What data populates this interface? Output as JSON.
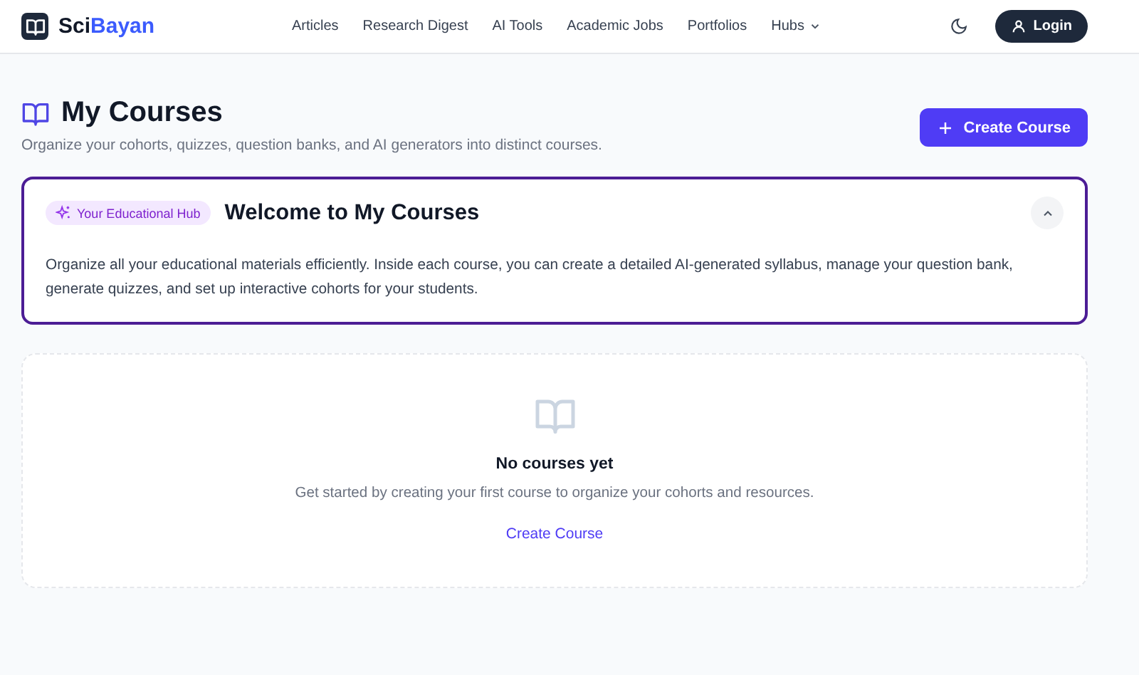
{
  "header": {
    "brand": [
      "Sci",
      "Bayan"
    ],
    "nav": [
      {
        "label": "Articles",
        "has_menu": false
      },
      {
        "label": "Research Digest",
        "has_menu": false
      },
      {
        "label": "AI Tools",
        "has_menu": false
      },
      {
        "label": "Academic Jobs",
        "has_menu": false
      },
      {
        "label": "Portfolios",
        "has_menu": false
      },
      {
        "label": "Hubs",
        "has_menu": true
      }
    ],
    "login": "Login"
  },
  "page": {
    "title": "My Courses",
    "subtitle": "Organize your cohorts, quizzes, question banks, and AI generators into distinct courses.",
    "create_button": "Create Course"
  },
  "welcome": {
    "badge": "Your Educational Hub",
    "title": "Welcome to My Courses",
    "expanded": true,
    "body": "Organize all your educational materials efficiently. Inside each course, you can create a detailed AI-generated syllabus, manage your question bank, generate quizzes, and set up interactive cohorts for your students."
  },
  "empty": {
    "title": "No courses yet",
    "text": "Get started by creating your first course to organize your cohorts and resources.",
    "link": "Create Course"
  }
}
